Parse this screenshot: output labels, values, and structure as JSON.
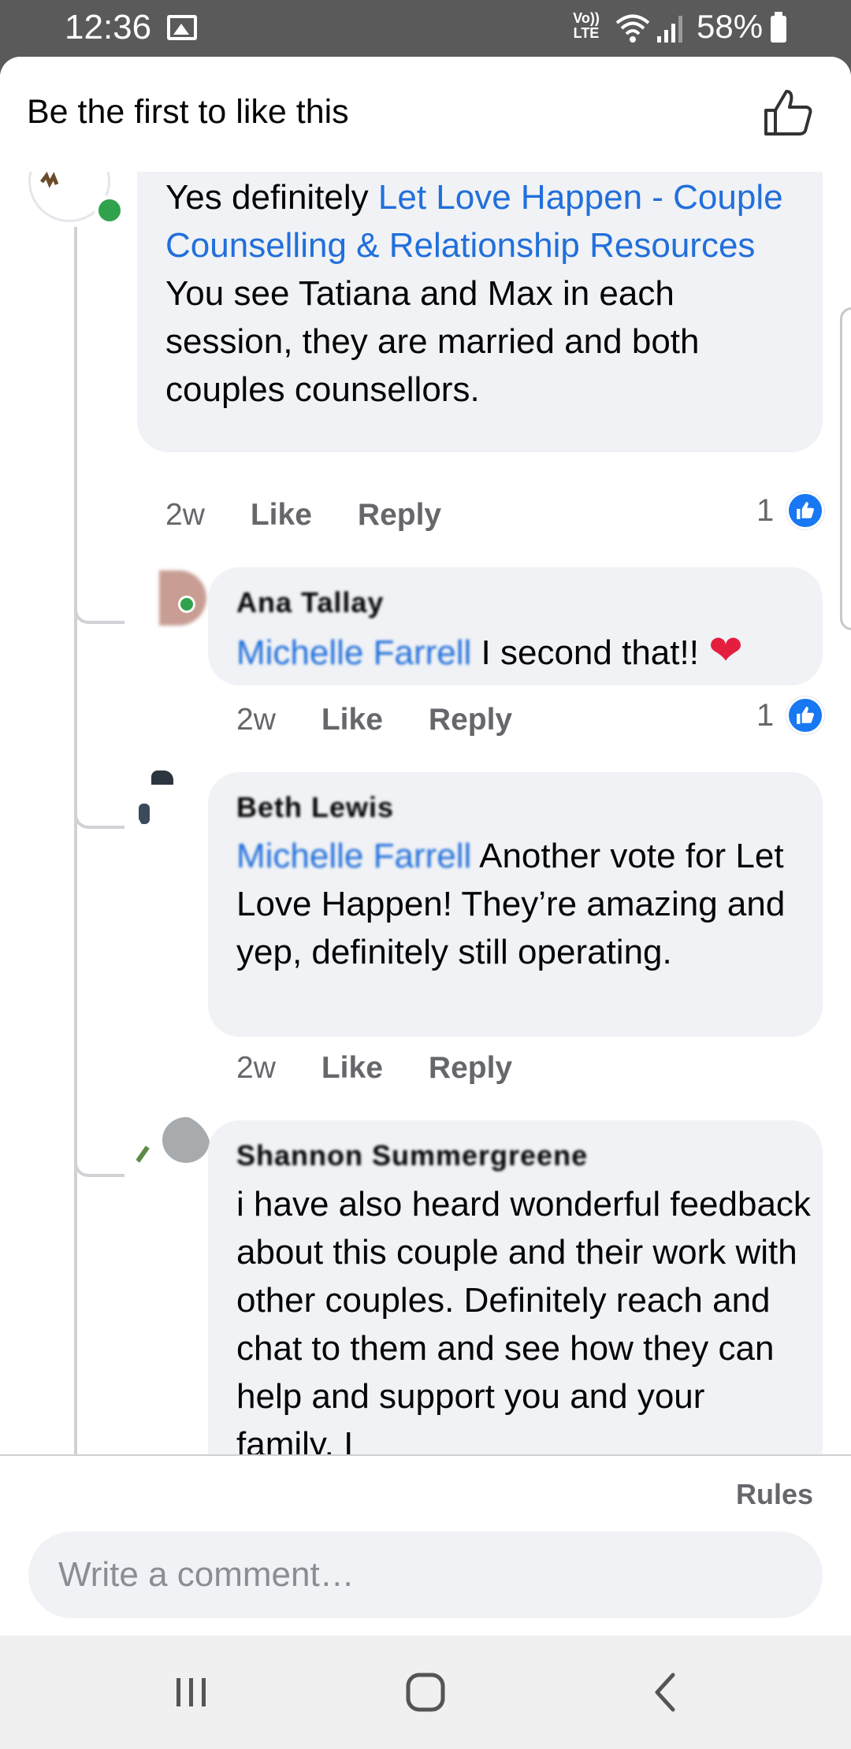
{
  "status_bar": {
    "time": "12:36",
    "network_label": "Vo)) LTE",
    "battery": "58%"
  },
  "sheet": {
    "title": "Be the first to like this"
  },
  "comments": [
    {
      "link_text": "Let Love Happen - Couple Counselling & Relationship Resources",
      "prefix": "Yes definitely ",
      "body": "You see Tatiana and Max in each session, they are married and both couples counsellors.",
      "time": "2w",
      "like_label": "Like",
      "reply_label": "Reply",
      "reactions": "1"
    },
    {
      "author": "Ana Tallay",
      "mention": "Michelle Farrell",
      "body": "I second that!!",
      "time": "2w",
      "like_label": "Like",
      "reply_label": "Reply",
      "reactions": "1"
    },
    {
      "author": "Beth Lewis",
      "mention": "Michelle Farrell",
      "body": "Another vote for Let Love Happen! They’re amazing and yep, definitely still operating.",
      "time": "2w",
      "like_label": "Like",
      "reply_label": "Reply"
    },
    {
      "author": "Shannon Summergreene",
      "body": "i have also heard wonderful feedback about this couple and their work with other couples. Definitely reach and chat to them and see how they can help and support you and your family. I"
    }
  ],
  "composer": {
    "rules_label": "Rules",
    "placeholder": "Write a comment…"
  },
  "colors": {
    "link": "#216fdb",
    "bubble": "#f0f2f5",
    "meta": "#65676b",
    "like_blue": "#1877f2",
    "online": "#31a24c"
  }
}
